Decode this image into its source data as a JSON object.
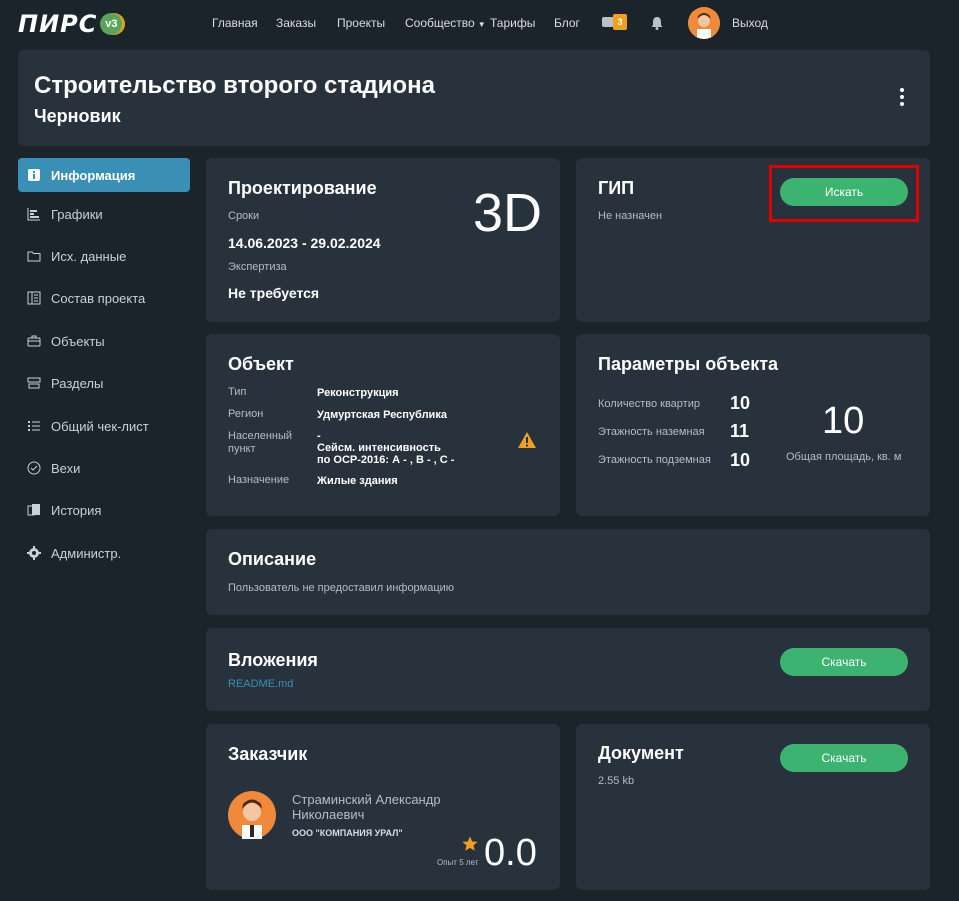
{
  "nav": {
    "logo_text": "ПИРС",
    "logo_version": "v3",
    "links": [
      "Главная",
      "Заказы",
      "Проекты",
      "Сообщество",
      "Тарифы",
      "Блог"
    ],
    "messages_count": "3",
    "logout": "Выход"
  },
  "header": {
    "title": "Строительство второго стадиона",
    "status": "Черновик"
  },
  "sidebar": {
    "items": [
      {
        "label": "Информация",
        "icon": "info-icon",
        "active": true
      },
      {
        "label": "Графики",
        "icon": "chart-icon"
      },
      {
        "label": "Исх. данные",
        "icon": "folder-icon"
      },
      {
        "label": "Состав проекта",
        "icon": "book-icon"
      },
      {
        "label": "Объекты",
        "icon": "briefcase-icon"
      },
      {
        "label": "Разделы",
        "icon": "sections-icon"
      },
      {
        "label": "Общий чек-лист",
        "icon": "checklist-icon"
      },
      {
        "label": "Вехи",
        "icon": "check-circle-icon"
      },
      {
        "label": "История",
        "icon": "history-icon"
      },
      {
        "label": "Администр.",
        "icon": "gear-icon"
      }
    ]
  },
  "design": {
    "title": "Проектирование",
    "terms_label": "Сроки",
    "terms_value": "14.06.2023 - 29.02.2024",
    "expertise_label": "Экспертиза",
    "expertise_value": "Не требуется",
    "mode": "3D"
  },
  "gip": {
    "title": "ГИП",
    "status": "Не назначен",
    "search_button": "Искать"
  },
  "object": {
    "title": "Объект",
    "type_label": "Тип",
    "type_value": "Реконструкция",
    "region_label": "Регион",
    "region_value": "Удмуртская Республика",
    "locality_label_1": "Населенный",
    "locality_label_2": "пункт",
    "locality_value": "-",
    "seismic_1": "Сейсм. интенсивность",
    "seismic_2": "по ОСР-2016: А - , В - , С -",
    "purpose_label": "Назначение",
    "purpose_value": "Жилые здания"
  },
  "params": {
    "title": "Параметры объекта",
    "apartments_label": "Количество квартир",
    "apartments_value": "10",
    "floors_above_label": "Этажность наземная",
    "floors_above_value": "11",
    "floors_below_label": "Этажность подземная",
    "floors_below_value": "10",
    "area_value": "10",
    "area_label": "Общая площадь, кв. м"
  },
  "description": {
    "title": "Описание",
    "text": "Пользователь не предоставил информацию"
  },
  "attachments": {
    "title": "Вложения",
    "file": "README.md",
    "download_button": "Скачать"
  },
  "customer": {
    "title": "Заказчик",
    "name_1": "Страминский Александр",
    "name_2": "Николаевич",
    "company": "ООО \"КОМПАНИЯ УРАЛ\"",
    "experience": "Опыт 5 лет",
    "rating": "0.0"
  },
  "document": {
    "title": "Документ",
    "size": "2.55 kb",
    "download_button": "Скачать"
  },
  "colors": {
    "background": "#1b232b",
    "card": "#28323c",
    "accent_blue": "#3a8fb7",
    "button_green": "#3cb371",
    "badge_orange": "#f0a020",
    "highlight_red": "#e10000"
  }
}
